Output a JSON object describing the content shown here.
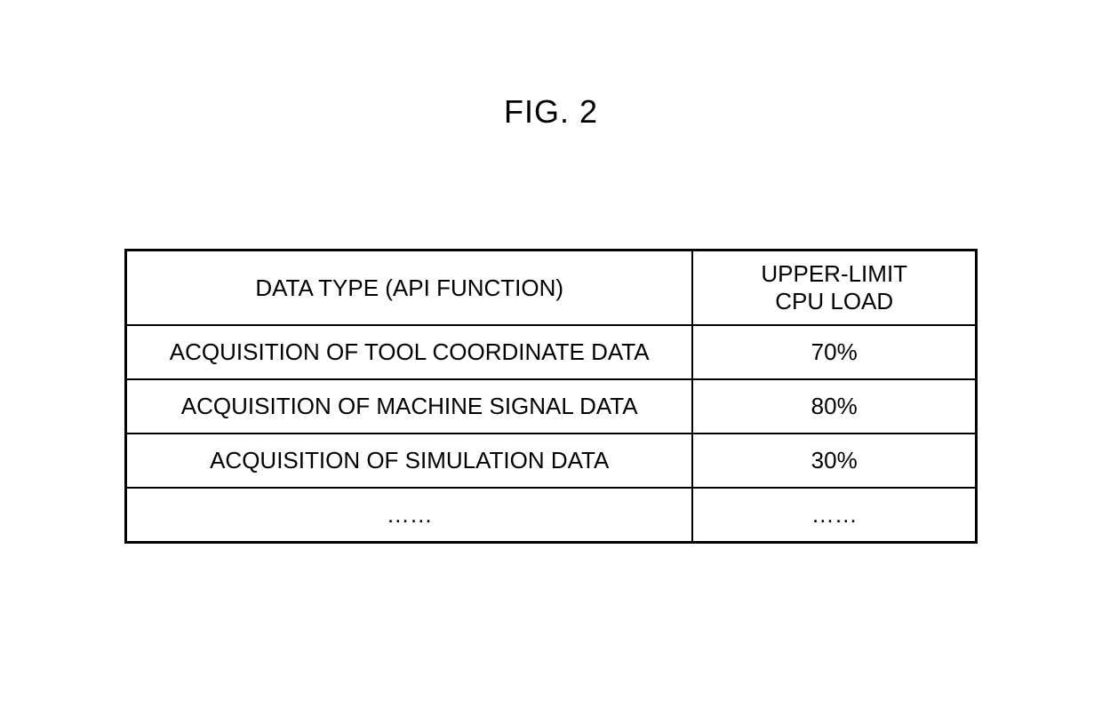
{
  "figure_label": "FIG. 2",
  "table": {
    "header": {
      "data_type": "DATA TYPE (API FUNCTION)",
      "upper_limit": "UPPER-LIMIT\nCPU LOAD"
    },
    "rows": [
      {
        "data_type": "ACQUISITION OF TOOL COORDINATE DATA",
        "upper_limit": "70%"
      },
      {
        "data_type": "ACQUISITION OF MACHINE SIGNAL DATA",
        "upper_limit": "80%"
      },
      {
        "data_type": "ACQUISITION OF SIMULATION DATA",
        "upper_limit": "30%"
      },
      {
        "data_type": "……",
        "upper_limit": "……"
      }
    ]
  },
  "chart_data": {
    "type": "table",
    "title": "FIG. 2",
    "columns": [
      "DATA TYPE (API FUNCTION)",
      "UPPER-LIMIT CPU LOAD"
    ],
    "rows": [
      [
        "ACQUISITION OF TOOL COORDINATE DATA",
        "70%"
      ],
      [
        "ACQUISITION OF MACHINE SIGNAL DATA",
        "80%"
      ],
      [
        "ACQUISITION OF SIMULATION DATA",
        "30%"
      ],
      [
        "……",
        "……"
      ]
    ]
  }
}
